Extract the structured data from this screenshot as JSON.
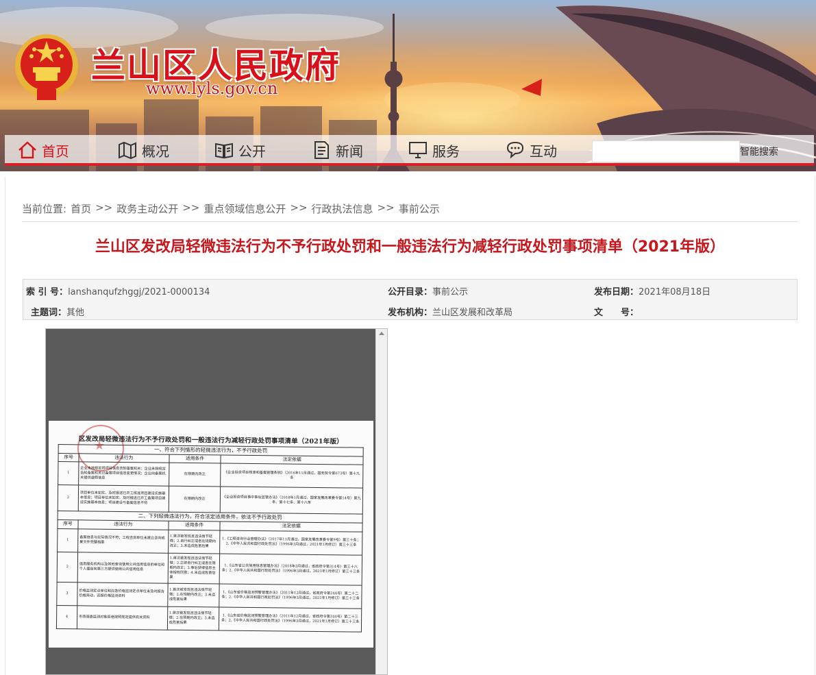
{
  "site": {
    "title": "兰山区人民政府",
    "url": "www.lyls.gov.cn"
  },
  "nav": {
    "items": [
      {
        "label": "首页",
        "icon": "home-icon",
        "active": true
      },
      {
        "label": "概况",
        "icon": "map-icon"
      },
      {
        "label": "公开",
        "icon": "book-icon"
      },
      {
        "label": "新闻",
        "icon": "document-icon"
      },
      {
        "label": "服务",
        "icon": "monitor-icon"
      },
      {
        "label": "互动",
        "icon": "chat-icon"
      }
    ],
    "search_placeholder": "",
    "search_button": "智能搜索"
  },
  "breadcrumb": {
    "prefix": "当前位置:",
    "separator": ">>",
    "items": [
      "首页",
      "政务主动公开",
      "重点领域信息公开",
      "行政执法信息",
      "事前公示"
    ]
  },
  "article": {
    "title": "兰山区发改局轻微违法行为不予行政处罚和一般违法行为减轻行政处罚事项清单（2021年版）"
  },
  "meta": {
    "index_label": "索 引 号：",
    "index_value": "lanshanqufzhggj/2021-0000134",
    "catalog_label": "公开目录：",
    "catalog_value": "事前公示",
    "date_label": "发布日期：",
    "date_value": "2021年08月18日",
    "topic_label": "主题词：",
    "topic_value": "其他",
    "org_label": "发布机构：",
    "org_value": "兰山区发展和改革局",
    "docno_label": "文　　号：",
    "docno_value": ""
  },
  "document": {
    "title": "区发改局轻微违法行为不予行政处罚和一般违法行为减轻行政处罚事项清单（2021年版）",
    "section1": "一、符合下列情形的轻微违法行为，不予行政处罚",
    "section2": "二、下列轻微违法行为，符合法定适用条件，依法不予行政处罚",
    "headers": [
      "序号",
      "违法行为",
      "适用条件",
      "法定依据"
    ],
    "rows1": [
      {
        "no": "1",
        "act": "企业未按规定将项目信息告知备案机关；企业未按规定告知备案机关已备案项目信息变更情况；企业向备案机关提供虚假信息",
        "cond": "在限期内改正",
        "basis": "《企业投资项目核准和备案管理条例》（2016年11月通过，国务院令第673号）第十九条"
      },
      {
        "no": "2",
        "act": "项目单位未如实、及时报送已开工核准项目建设实施基本信息；项目单位未如实、及时报送已开工备案项目建设实施基本信息；项目建设与备案信息不符",
        "cond": "在限期内改正",
        "basis": "《企业投资项目事中事后监管办法》（2018年1月通过，国家发展改革委令第14号）第九条、第十七条、第十八条"
      }
    ],
    "rows2": [
      {
        "no": "1",
        "act": "备案信息与实际情况不符；工程咨询单位未建立咨询成果文件完整档案",
        "cond": "1.首次被发现且违法情节轻微；2.自行纠正或者在规期内改正；3.未造成危害后果",
        "basis": "1.《工程咨询行业管理办法》（2017年11月通过，国家发展改革委令第9号）第三十条；2.《中华人民共和国行政处罚法》（1996年3月通过，2021年1月修订）第三十三条"
      },
      {
        "no": "2",
        "act": "信用服务机构以及其他查询使用公共信用信息的单位和个人擅自向第三方提供使用公共信用信息",
        "cond": "1.首次被发现且违法情节轻微；2.立即自行纠正或者在限期内改正；3.事后获得信息主体授权同意；4.未造成危害后果",
        "basis": "1.《山东省公共信用信息管理办法》（2018年3月通过，省政府令第314号）第三十八条；2.《中华人民共和国行政处罚法》（1996年3月通过，2021年1月修订）第三十三条"
      },
      {
        "no": "3",
        "act": "价格监测定点单位和应急价格监测定点单位未及时报告价格异动，迟报价格监测资料",
        "cond": "1.首次被发现且违法情节轻微；2.在规期内改正；3.未造成危害后果",
        "basis": "1.《山东省价格监测预警管理办法》（2011年12月通过，省政府令第244号）第二十二条；2.《中华人民共和国行政处罚法》（1996年3月通过，2021年1月修订）第三十三条"
      },
      {
        "no": "4",
        "act": "市场调查监测对象拒绝按照规定提供有关资料",
        "cond": "1.首次被发现且违法情节轻微；2.在限期内改正；3.未造成危害后果",
        "basis": "1.《山东省价格监测预警管理办法》（2011年12月通过，省政府令第244号）第二十三条；2.《中华人民共和国行政处罚法》（1996年3月通过，2021年1月修订）第三十三条"
      }
    ]
  }
}
